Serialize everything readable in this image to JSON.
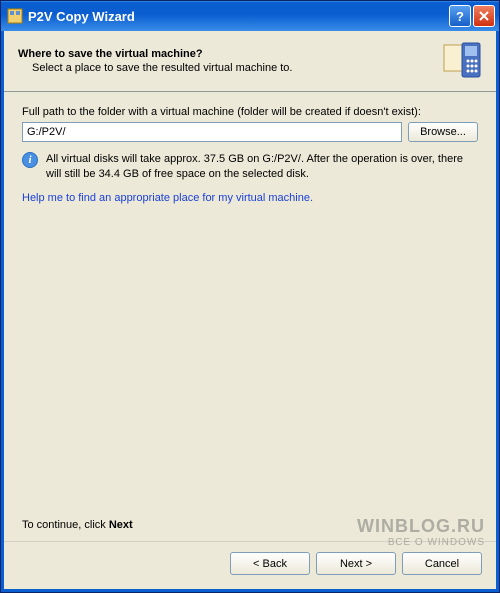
{
  "window": {
    "title": "P2V Copy Wizard"
  },
  "header": {
    "title": "Where to save the virtual machine?",
    "subtitle": "Select a place to save the resulted virtual machine to."
  },
  "body": {
    "path_label": "Full path to the folder with a virtual machine (folder will be created if doesn't exist):",
    "path_value": "G:/P2V/",
    "browse_label": "Browse...",
    "info_text": "All virtual disks will take approx. 37.5 GB on G:/P2V/. After the operation is over, there will still be 34.4 GB of free space on the selected disk.",
    "help_link": "Help me to find an appropriate place for my virtual machine.",
    "continue_prefix": "To continue, click ",
    "continue_bold": "Next"
  },
  "footer": {
    "back_label": "< Back",
    "next_label": "Next >",
    "cancel_label": "Cancel"
  },
  "watermark": {
    "line1": "WINBLOG.RU",
    "line2": "ВСЕ О WINDOWS"
  }
}
